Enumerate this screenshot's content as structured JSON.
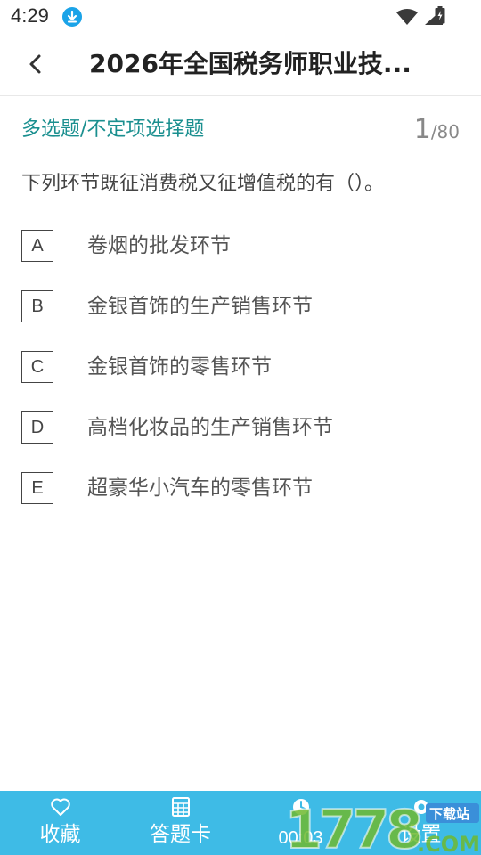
{
  "status": {
    "time": "4:29"
  },
  "header": {
    "title": "2026年全国税务师职业技..."
  },
  "question": {
    "type": "多选题/不定项选择题",
    "current": "1",
    "total": "/80",
    "stem": "下列环节既征消费税又征增值税的有（）。"
  },
  "options": [
    {
      "letter": "A",
      "text": "卷烟的批发环节"
    },
    {
      "letter": "B",
      "text": "金银首饰的生产销售环节"
    },
    {
      "letter": "C",
      "text": "金银首饰的零售环节"
    },
    {
      "letter": "D",
      "text": "高档化妆品的生产销售环节"
    },
    {
      "letter": "E",
      "text": "超豪华小汽车的零售环节"
    }
  ],
  "bottom_bar": {
    "favorite": "收藏",
    "answer_card": "答题卡",
    "timer": "00:03",
    "settings": "设置"
  },
  "watermark": {
    "number": "1778",
    "site": "下载站",
    "suffix": ".COM"
  },
  "colors": {
    "accent": "#1a8f8f",
    "bottom_bar": "#3ebbe6",
    "download_badge": "#1aa3e8"
  }
}
